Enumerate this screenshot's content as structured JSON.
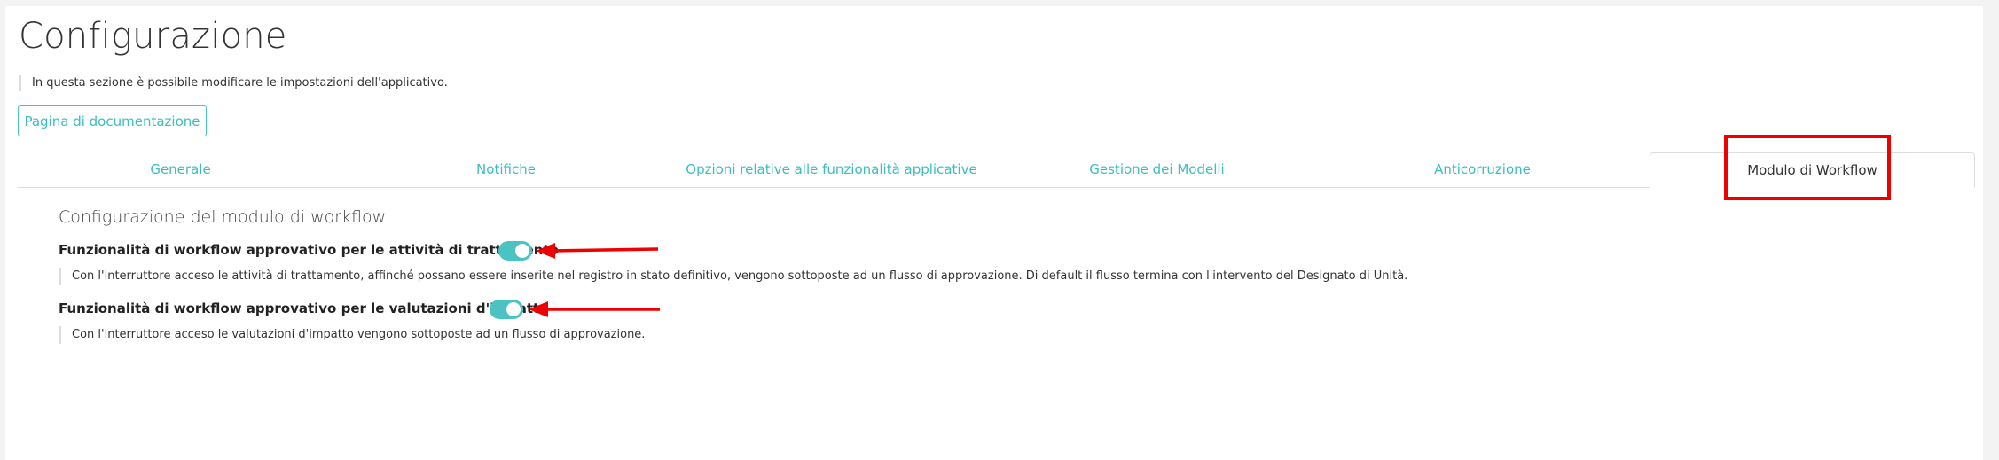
{
  "page": {
    "title": "Configurazione",
    "intro": "In questa sezione è possibile modificare le impostazioni dell'applicativo.",
    "doc_button": "Pagina di documentazione"
  },
  "tabs": [
    {
      "label": "Generale",
      "active": false
    },
    {
      "label": "Notifiche",
      "active": false
    },
    {
      "label": "Opzioni relative alle funzionalità applicative",
      "active": false
    },
    {
      "label": "Gestione dei Modelli",
      "active": false
    },
    {
      "label": "Anticorruzione",
      "active": false
    },
    {
      "label": "Modulo di Workflow",
      "active": true
    }
  ],
  "workflow": {
    "section_title": "Configurazione del modulo di workflow",
    "settings": [
      {
        "label": "Funzionalità di workflow approvativo per le attività di trattamento",
        "enabled": true,
        "description": "Con l'interruttore acceso le attività di trattamento, affinché possano essere inserite nel registro in stato definitivo, vengono sottoposte ad un flusso di approvazione. Di default il flusso termina con l'intervento del Designato di Unità."
      },
      {
        "label": "Funzionalità di workflow approvativo per le valutazioni d'impatto",
        "enabled": true,
        "description": "Con l'interruttore acceso le valutazioni d'impatto vengono sottoposte ad un flusso di approvazione."
      }
    ]
  },
  "colors": {
    "accent": "#4cc3c3",
    "annotation": "#ee0000"
  }
}
